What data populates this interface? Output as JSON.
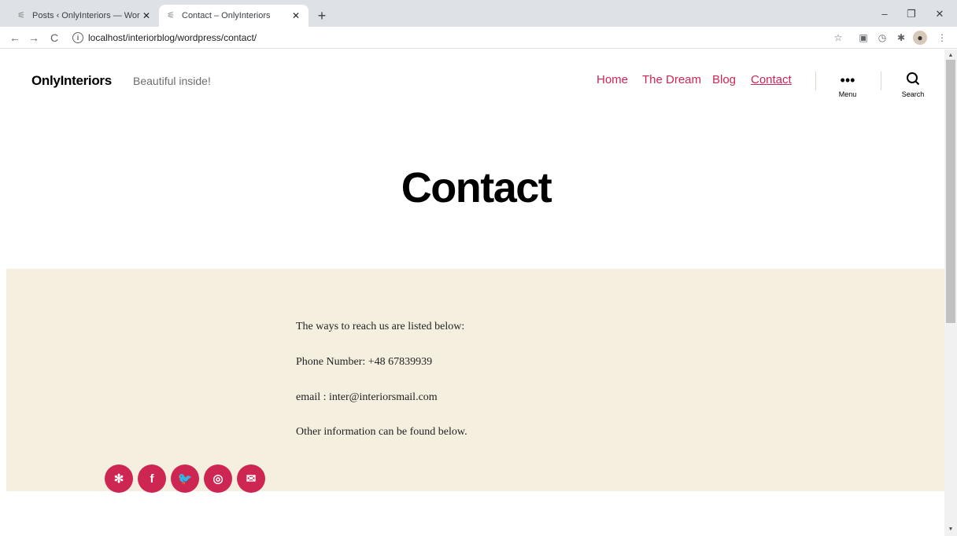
{
  "browser": {
    "tabs": [
      {
        "title": "Posts ‹ OnlyInteriors — WordPre",
        "active": false
      },
      {
        "title": "Contact – OnlyInteriors",
        "active": true
      }
    ],
    "new_tab": "+",
    "url": "localhost/interiorblog/wordpress/contact/",
    "icons": {
      "back": "arrow-left-icon",
      "forward": "arrow-right-icon",
      "reload": "reload-icon",
      "info": "info-icon",
      "star": "star-icon",
      "extensions": [
        "extension-square-icon",
        "extension-check-icon",
        "puzzle-icon",
        "profile-avatar",
        "kebab-menu-icon"
      ]
    }
  },
  "site": {
    "title": "OnlyInteriors",
    "tagline": "Beautiful inside!",
    "nav": [
      {
        "label": "Home",
        "current": false
      },
      {
        "label": "The Dream",
        "current": false
      },
      {
        "label": "Blog",
        "current": false
      },
      {
        "label": "Contact",
        "current": true
      }
    ],
    "menu_label": "Menu",
    "search_label": "Search"
  },
  "page": {
    "title": "Contact",
    "paragraphs": [
      "The ways to reach us are listed below:",
      "Phone Number: +48 67839939",
      "email : inter@interiorsmail.com",
      "Other information can be found below."
    ]
  },
  "social": [
    {
      "name": "yelp-icon",
      "glyph": "✻"
    },
    {
      "name": "facebook-icon",
      "glyph": "f"
    },
    {
      "name": "twitter-icon",
      "glyph": "🐦"
    },
    {
      "name": "instagram-icon",
      "glyph": "◎"
    },
    {
      "name": "email-icon",
      "glyph": "✉"
    }
  ],
  "colors": {
    "accent": "#cd2653",
    "band_background": "#f5efe0",
    "tabbar": "#dee1e6"
  }
}
